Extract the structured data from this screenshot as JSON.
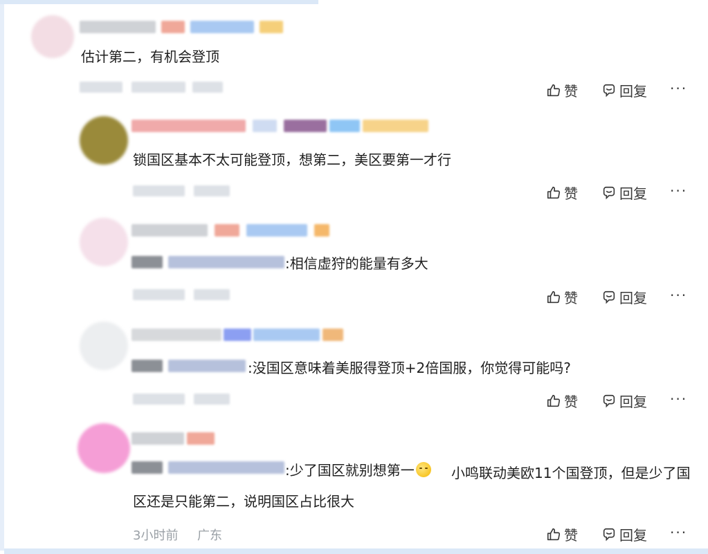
{
  "comments": [
    {
      "text": "估计第二，有机会登顶",
      "actions": {
        "like": "赞",
        "reply": "回复",
        "more": "···"
      }
    },
    {
      "text": "锁国区基本不太可能登顶，想第二，美区要第一才行",
      "actions": {
        "like": "赞",
        "reply": "回复",
        "more": "···"
      }
    },
    {
      "text": ":相信虚狩的能量有多大",
      "actions": {
        "like": "赞",
        "reply": "回复",
        "more": "···"
      }
    },
    {
      "text": ":没国区意味着美服得登顶+2倍国服，你觉得可能吗?",
      "actions": {
        "like": "赞",
        "reply": "回复",
        "more": "···"
      }
    },
    {
      "text_before_emoji": ":少了国区就别想第一",
      "text_after_emoji": "小鸣联动美欧11个国登顶，但是少了国区还是只能第二，说明国区占比很大",
      "time": "3小时前",
      "location": "广东",
      "actions": {
        "like": "赞",
        "reply": "回复",
        "more": "···"
      }
    }
  ],
  "colors": {
    "text": "#1f1f1f",
    "meta": "#9aa0a6",
    "action": "#3a3a3a",
    "frame": "#dbe8f7"
  }
}
